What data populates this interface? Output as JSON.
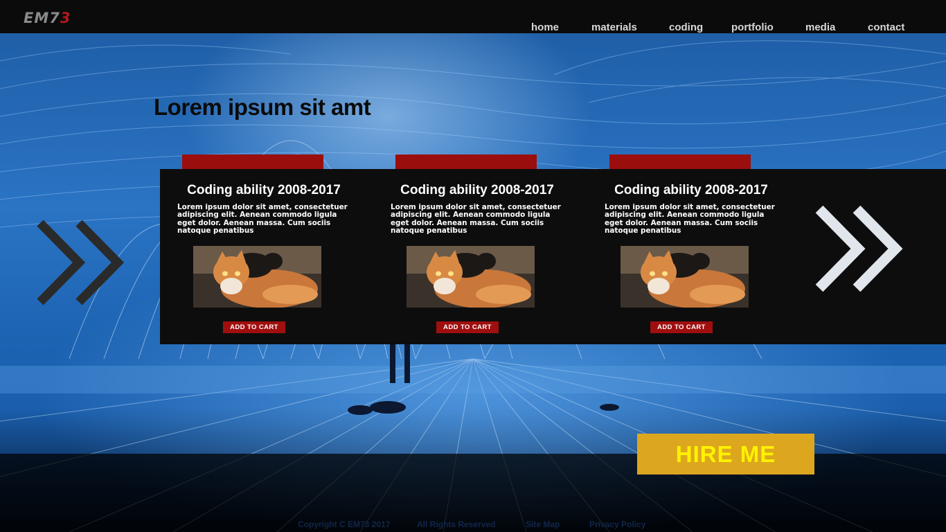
{
  "header": {
    "logo": {
      "part1": "EM7",
      "part2": "3"
    },
    "nav": [
      "home",
      "materials",
      "coding",
      "portfolio",
      "media",
      "contact"
    ]
  },
  "hero": {
    "headline": "Lorem ipsum sit amt"
  },
  "cards": [
    {
      "title": "Coding ability 2008-2017",
      "text": "Lorem ipsum dolor sit amet, consectetuer adipiscing elit. Aenean commodo ligula eget dolor. Aenean massa. Cum sociis natoque penatibus",
      "image": "kittens-photo",
      "button": "ADD TO CART"
    },
    {
      "title": "Coding ability 2008-2017",
      "text": "Lorem ipsum dolor sit amet, consectetuer adipiscing elit. Aenean commodo ligula eget dolor. Aenean massa. Cum sociis natoque penatibus",
      "image": "kittens-photo",
      "button": "ADD TO CART"
    },
    {
      "title": "Coding ability 2008-2017",
      "text": "Lorem ipsum dolor sit amet, consectetuer adipiscing elit. Aenean commodo ligula eget dolor. Aenean massa. Cum sociis natoque penatibus",
      "image": "kittens-photo",
      "button": "ADD TO CART"
    }
  ],
  "carousel": {
    "prev_icon": "double-chevron-icon",
    "next_icon": "double-chevron-right-icon"
  },
  "cta": {
    "label": "HIRE ME"
  },
  "footer": {
    "copyright": "Copyright C EM73 2017",
    "rights": "All Rights Reserved",
    "sitemap": "Site Map",
    "privacy": "Privacy Policy"
  },
  "colors": {
    "header_bg": "#0b0b0b",
    "accent_red": "#9b0e0e",
    "cta_bg": "#dca71f",
    "cta_text": "#fff200",
    "sky_blue": "#2b74c4"
  }
}
